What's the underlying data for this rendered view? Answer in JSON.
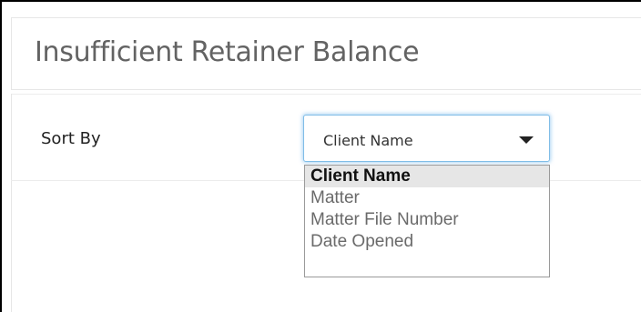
{
  "panel": {
    "title": "Insufficient Retainer Balance"
  },
  "sort": {
    "label": "Sort By",
    "selected": "Client Name",
    "options": [
      "Client Name",
      "Matter",
      "Matter File Number",
      "Date Opened"
    ]
  },
  "icons": {
    "caret": "caret-down-icon"
  },
  "colors": {
    "focus_border": "#80bde7",
    "selected_option_bg": "#e6e6e6"
  }
}
